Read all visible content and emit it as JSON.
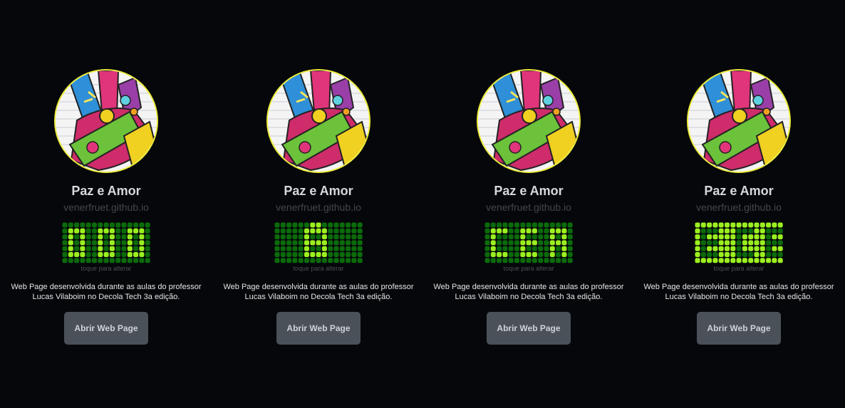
{
  "colors": {
    "background": "#05070a",
    "avatar_border": "#ecec3a",
    "led_on": "#9cf01f",
    "led_off": "#0b6b0b",
    "button_bg": "#4a5159"
  },
  "cards": [
    {
      "title": "Paz e Amor",
      "url": "venerfruet.github.io",
      "hint": "toque para alterar",
      "description_line1": "Web Page desenvolvida durante as aulas do professor",
      "description_line2": "Lucas Vilaboim no Decola Tech 3a edição.",
      "button_label": "Abrir Web Page",
      "avatar_icon": "peace-love-drawing-icon",
      "matrix_pattern": [
        "000000000000000",
        "011100111001110",
        "010100101001010",
        "010100101001010",
        "010100101001010",
        "011100111001110",
        "000000000000000"
      ]
    },
    {
      "title": "Paz e Amor",
      "url": "venerfruet.github.io",
      "hint": "toque para alterar",
      "description_line1": "Web Page desenvolvida durante as aulas do professor",
      "description_line2": "Lucas Vilaboim no Decola Tech 3a edição.",
      "button_label": "Abrir Web Page",
      "avatar_icon": "peace-love-drawing-icon",
      "matrix_pattern": [
        "000000110000000",
        "000001111000000",
        "000001001000000",
        "000001111000000",
        "000001001000000",
        "000001111000000",
        "000000000000000"
      ]
    },
    {
      "title": "Paz e Amor",
      "url": "venerfruet.github.io",
      "hint": "toque para alterar",
      "description_line1": "Web Page desenvolvida durante as aulas do professor",
      "description_line2": "Lucas Vilaboim no Decola Tech 3a edição.",
      "button_label": "Abrir Web Page",
      "avatar_icon": "peace-love-drawing-icon",
      "matrix_pattern": [
        "000000000000000",
        "011100111001110",
        "010000100001010",
        "010000111001110",
        "010000100001010",
        "011100111001010",
        "000000000000000"
      ]
    },
    {
      "title": "Paz e Amor",
      "url": "venerfruet.github.io",
      "hint": "toque para alterar",
      "description_line1": "Web Page desenvolvida durante as aulas do professor",
      "description_line2": "Lucas Vilaboim no Decola Tech 3a edição.",
      "button_label": "Abrir Web Page",
      "avatar_icon": "peace-love-drawing-icon",
      "matrix_pattern": [
        "111111111111111",
        "100011100011000",
        "101111101111011",
        "100011101111000",
        "101111101111011",
        "100011100011000",
        "111111111111111"
      ]
    }
  ]
}
